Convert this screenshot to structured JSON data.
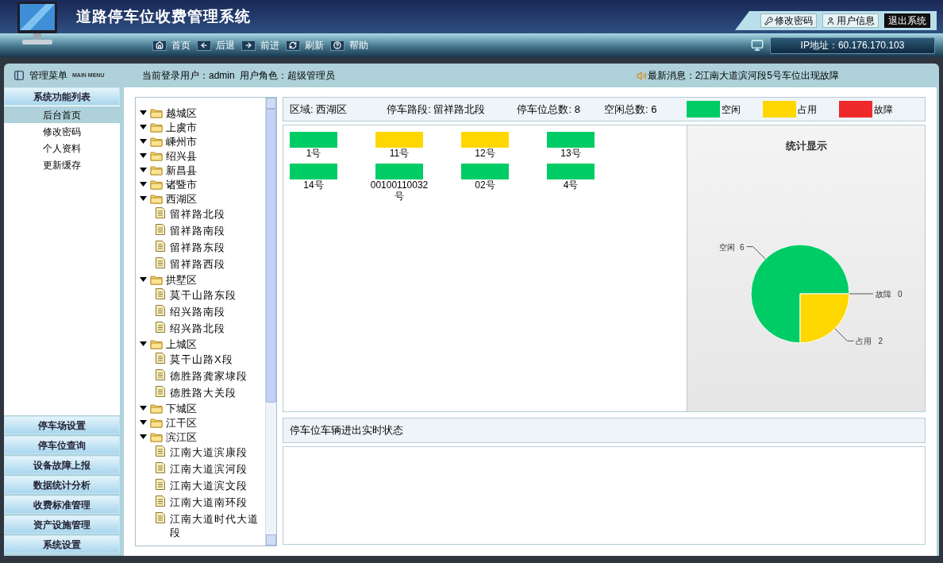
{
  "header": {
    "title": "道路停车位收费管理系统",
    "buttons": [
      {
        "kind": "key",
        "label": "修改密码"
      },
      {
        "kind": "user",
        "label": "用户信息"
      },
      {
        "kind": "exit",
        "label": "退出系统"
      }
    ]
  },
  "nav": {
    "items": [
      {
        "label": "首页"
      },
      {
        "label": "后退"
      },
      {
        "label": "前进"
      },
      {
        "label": "刷新"
      },
      {
        "label": "帮助"
      }
    ],
    "ip": "IP地址：60.176.170.103"
  },
  "menu_header": {
    "title": "管理菜单",
    "subtitle": "MAIN MENU"
  },
  "user_info": "当前登录用户：admin  用户角色：超级管理员",
  "news": "最新消息：2江南大道滨河段5号车位出现故障",
  "sidebar": {
    "section": "系统功能列表",
    "items": [
      {
        "label": "后台首页",
        "selected": true
      },
      {
        "label": "修改密码",
        "selected": false
      },
      {
        "label": "个人资料",
        "selected": false
      },
      {
        "label": "更新缓存",
        "selected": false
      }
    ],
    "sections": [
      "停车场设置",
      "停车位查询",
      "设备故障上报",
      "数据统计分析",
      "收费标准管理",
      "资产设施管理",
      "系统设置"
    ]
  },
  "tree": [
    {
      "label": "越城区",
      "expanded": true
    },
    {
      "label": "上虞市",
      "expanded": true
    },
    {
      "label": "嵊州市",
      "expanded": true
    },
    {
      "label": "绍兴县",
      "expanded": true
    },
    {
      "label": "新昌县",
      "expanded": true
    },
    {
      "label": "诸暨市",
      "expanded": true
    },
    {
      "label": "西湖区",
      "expanded": true,
      "children": [
        {
          "label": "留祥路北段"
        },
        {
          "label": "留祥路南段"
        },
        {
          "label": "留祥路东段"
        },
        {
          "label": "留祥路西段"
        }
      ]
    },
    {
      "label": "拱墅区",
      "expanded": true,
      "children": [
        {
          "label": "莫干山路东段"
        },
        {
          "label": "绍兴路南段"
        },
        {
          "label": "绍兴路北段"
        }
      ]
    },
    {
      "label": "上城区",
      "expanded": true,
      "children": [
        {
          "label": "莫干山路X段"
        },
        {
          "label": "德胜路龚家埭段"
        },
        {
          "label": "德胜路大关段"
        }
      ]
    },
    {
      "label": "下城区",
      "expanded": true
    },
    {
      "label": "江干区",
      "expanded": true
    },
    {
      "label": "滨江区",
      "expanded": true,
      "children": [
        {
          "label": "江南大道滨康段"
        },
        {
          "label": "江南大道滨河段"
        },
        {
          "label": "江南大道滨文段"
        },
        {
          "label": "江南大道南环段"
        },
        {
          "label": "江南大道时代大道段"
        }
      ]
    }
  ],
  "info_bar": {
    "fields": [
      "区域: 西湖区",
      "停车路段: 留祥路北段",
      "停车位总数: 8",
      "空闲总数: 6"
    ],
    "legend": [
      {
        "label": "空闲",
        "color": "#00cc66"
      },
      {
        "label": "占用",
        "color": "#ffd700"
      },
      {
        "label": "故障",
        "color": "#ee2a2a"
      }
    ]
  },
  "spots": [
    {
      "label": "1号",
      "color": "#00cc66"
    },
    {
      "label": "11号",
      "color": "#ffd700"
    },
    {
      "label": "12号",
      "color": "#ffd700"
    },
    {
      "label": "13号",
      "color": "#00cc66"
    },
    {
      "label": "14号",
      "color": "#00cc66"
    },
    {
      "label": "00100110032号",
      "color": "#00cc66"
    },
    {
      "label": "02号",
      "color": "#00cc66"
    },
    {
      "label": "4号",
      "color": "#00cc66"
    }
  ],
  "stats": {
    "title": "统计显示",
    "chart_data": {
      "type": "pie",
      "categories": [
        "空闲",
        "占用",
        "故障"
      ],
      "series": [
        {
          "values": [
            6,
            2,
            0
          ]
        }
      ],
      "data_labels": true,
      "value_labels": [
        "6",
        "2",
        "0"
      ]
    }
  },
  "realtime": {
    "title": "停车位车辆进出实时状态"
  }
}
